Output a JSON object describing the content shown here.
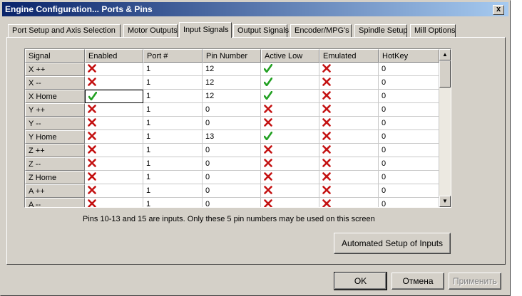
{
  "window": {
    "title": "Engine Configuration... Ports & Pins",
    "close_label": "x"
  },
  "tabs": [
    {
      "label": "Port Setup and Axis Selection"
    },
    {
      "label": "Motor Outputs"
    },
    {
      "label": "Input Signals",
      "active": true
    },
    {
      "label": "Output Signals"
    },
    {
      "label": "Encoder/MPG's"
    },
    {
      "label": "Spindle Setup"
    },
    {
      "label": "Mill Options"
    }
  ],
  "table": {
    "columns": [
      "Signal",
      "Enabled",
      "Port #",
      "Pin Number",
      "Active Low",
      "Emulated",
      "HotKey"
    ],
    "rows": [
      {
        "signal": "X ++",
        "enabled": false,
        "port": "1",
        "pin": "12",
        "active_low": true,
        "emulated": false,
        "hotkey": "0"
      },
      {
        "signal": "X --",
        "enabled": false,
        "port": "1",
        "pin": "12",
        "active_low": true,
        "emulated": false,
        "hotkey": "0"
      },
      {
        "signal": "X Home",
        "enabled": true,
        "port": "1",
        "pin": "12",
        "active_low": true,
        "emulated": false,
        "hotkey": "0",
        "selected_cell": "enabled"
      },
      {
        "signal": "Y ++",
        "enabled": false,
        "port": "1",
        "pin": "0",
        "active_low": false,
        "emulated": false,
        "hotkey": "0"
      },
      {
        "signal": "Y --",
        "enabled": false,
        "port": "1",
        "pin": "0",
        "active_low": false,
        "emulated": false,
        "hotkey": "0"
      },
      {
        "signal": "Y Home",
        "enabled": false,
        "port": "1",
        "pin": "13",
        "active_low": true,
        "emulated": false,
        "hotkey": "0"
      },
      {
        "signal": "Z ++",
        "enabled": false,
        "port": "1",
        "pin": "0",
        "active_low": false,
        "emulated": false,
        "hotkey": "0"
      },
      {
        "signal": "Z --",
        "enabled": false,
        "port": "1",
        "pin": "0",
        "active_low": false,
        "emulated": false,
        "hotkey": "0"
      },
      {
        "signal": "Z Home",
        "enabled": false,
        "port": "1",
        "pin": "0",
        "active_low": false,
        "emulated": false,
        "hotkey": "0"
      },
      {
        "signal": "A ++",
        "enabled": false,
        "port": "1",
        "pin": "0",
        "active_low": false,
        "emulated": false,
        "hotkey": "0"
      },
      {
        "signal": "A --",
        "enabled": false,
        "port": "1",
        "pin": "0",
        "active_low": false,
        "emulated": false,
        "hotkey": "0"
      }
    ],
    "check_color": "#22a022",
    "cross_color": "#c41212"
  },
  "note": "Pins 10-13 and 15 are inputs. Only these 5 pin numbers may be used on this screen",
  "buttons": {
    "auto_setup": "Automated Setup of Inputs",
    "ok": "OK",
    "cancel": "Отмена",
    "apply": "Применить"
  }
}
